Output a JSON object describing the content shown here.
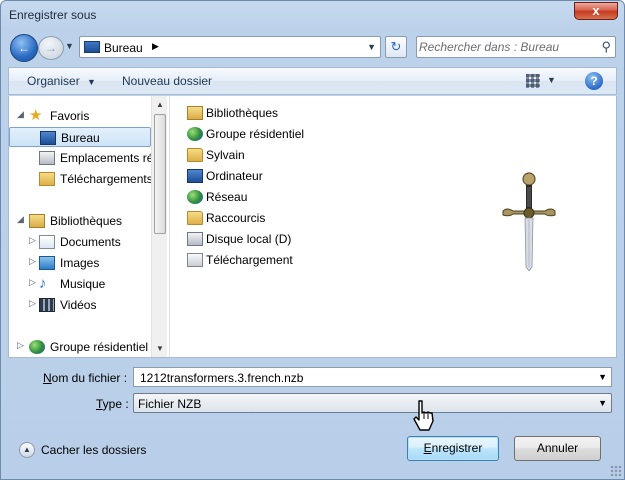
{
  "window": {
    "title": "Enregistrer sous",
    "close_label": "x"
  },
  "address": {
    "crumb": "Bureau",
    "search_placeholder": "Rechercher dans : Bureau"
  },
  "toolbar": {
    "organize_label": "Organiser",
    "new_folder_label": "Nouveau dossier",
    "help_label": "?"
  },
  "nav_pane": {
    "items": [
      {
        "label": "Favoris",
        "icon": "star-icon"
      },
      {
        "label": "Bureau",
        "icon": "desktop-icon",
        "selected": true
      },
      {
        "label": "Emplacements ré",
        "icon": "recent-places-icon"
      },
      {
        "label": "Téléchargements",
        "icon": "downloads-icon"
      },
      {
        "label": "Bibliothèques",
        "icon": "library-icon"
      },
      {
        "label": "Documents",
        "icon": "documents-icon"
      },
      {
        "label": "Images",
        "icon": "pictures-icon"
      },
      {
        "label": "Musique",
        "icon": "music-icon"
      },
      {
        "label": "Vidéos",
        "icon": "videos-icon"
      },
      {
        "label": "Groupe résidentiel",
        "icon": "homegroup-icon"
      }
    ]
  },
  "file_list": {
    "items": [
      {
        "label": "Bibliothèques",
        "icon": "library-icon"
      },
      {
        "label": "Groupe résidentiel",
        "icon": "homegroup-icon"
      },
      {
        "label": "Sylvain",
        "icon": "user-folder-icon"
      },
      {
        "label": "Ordinateur",
        "icon": "computer-icon"
      },
      {
        "label": "Réseau",
        "icon": "network-icon"
      },
      {
        "label": "Raccourcis",
        "icon": "folder-icon"
      },
      {
        "label": "Disque local (D)",
        "icon": "drive-shortcut-icon"
      },
      {
        "label": "Téléchargement",
        "icon": "shortcut-icon"
      }
    ]
  },
  "form": {
    "filename_label_prefix": "N",
    "filename_label_rest": "om du fichier :",
    "filename_value": "1212transformers.3.french.nzb",
    "type_label_prefix": "T",
    "type_label_rest": "ype :",
    "type_value": "Fichier NZB"
  },
  "footer": {
    "hide_folders_label": "Cacher les dossiers",
    "save_label_prefix": "E",
    "save_label_rest": "nregistrer",
    "cancel_label": "Annuler"
  }
}
